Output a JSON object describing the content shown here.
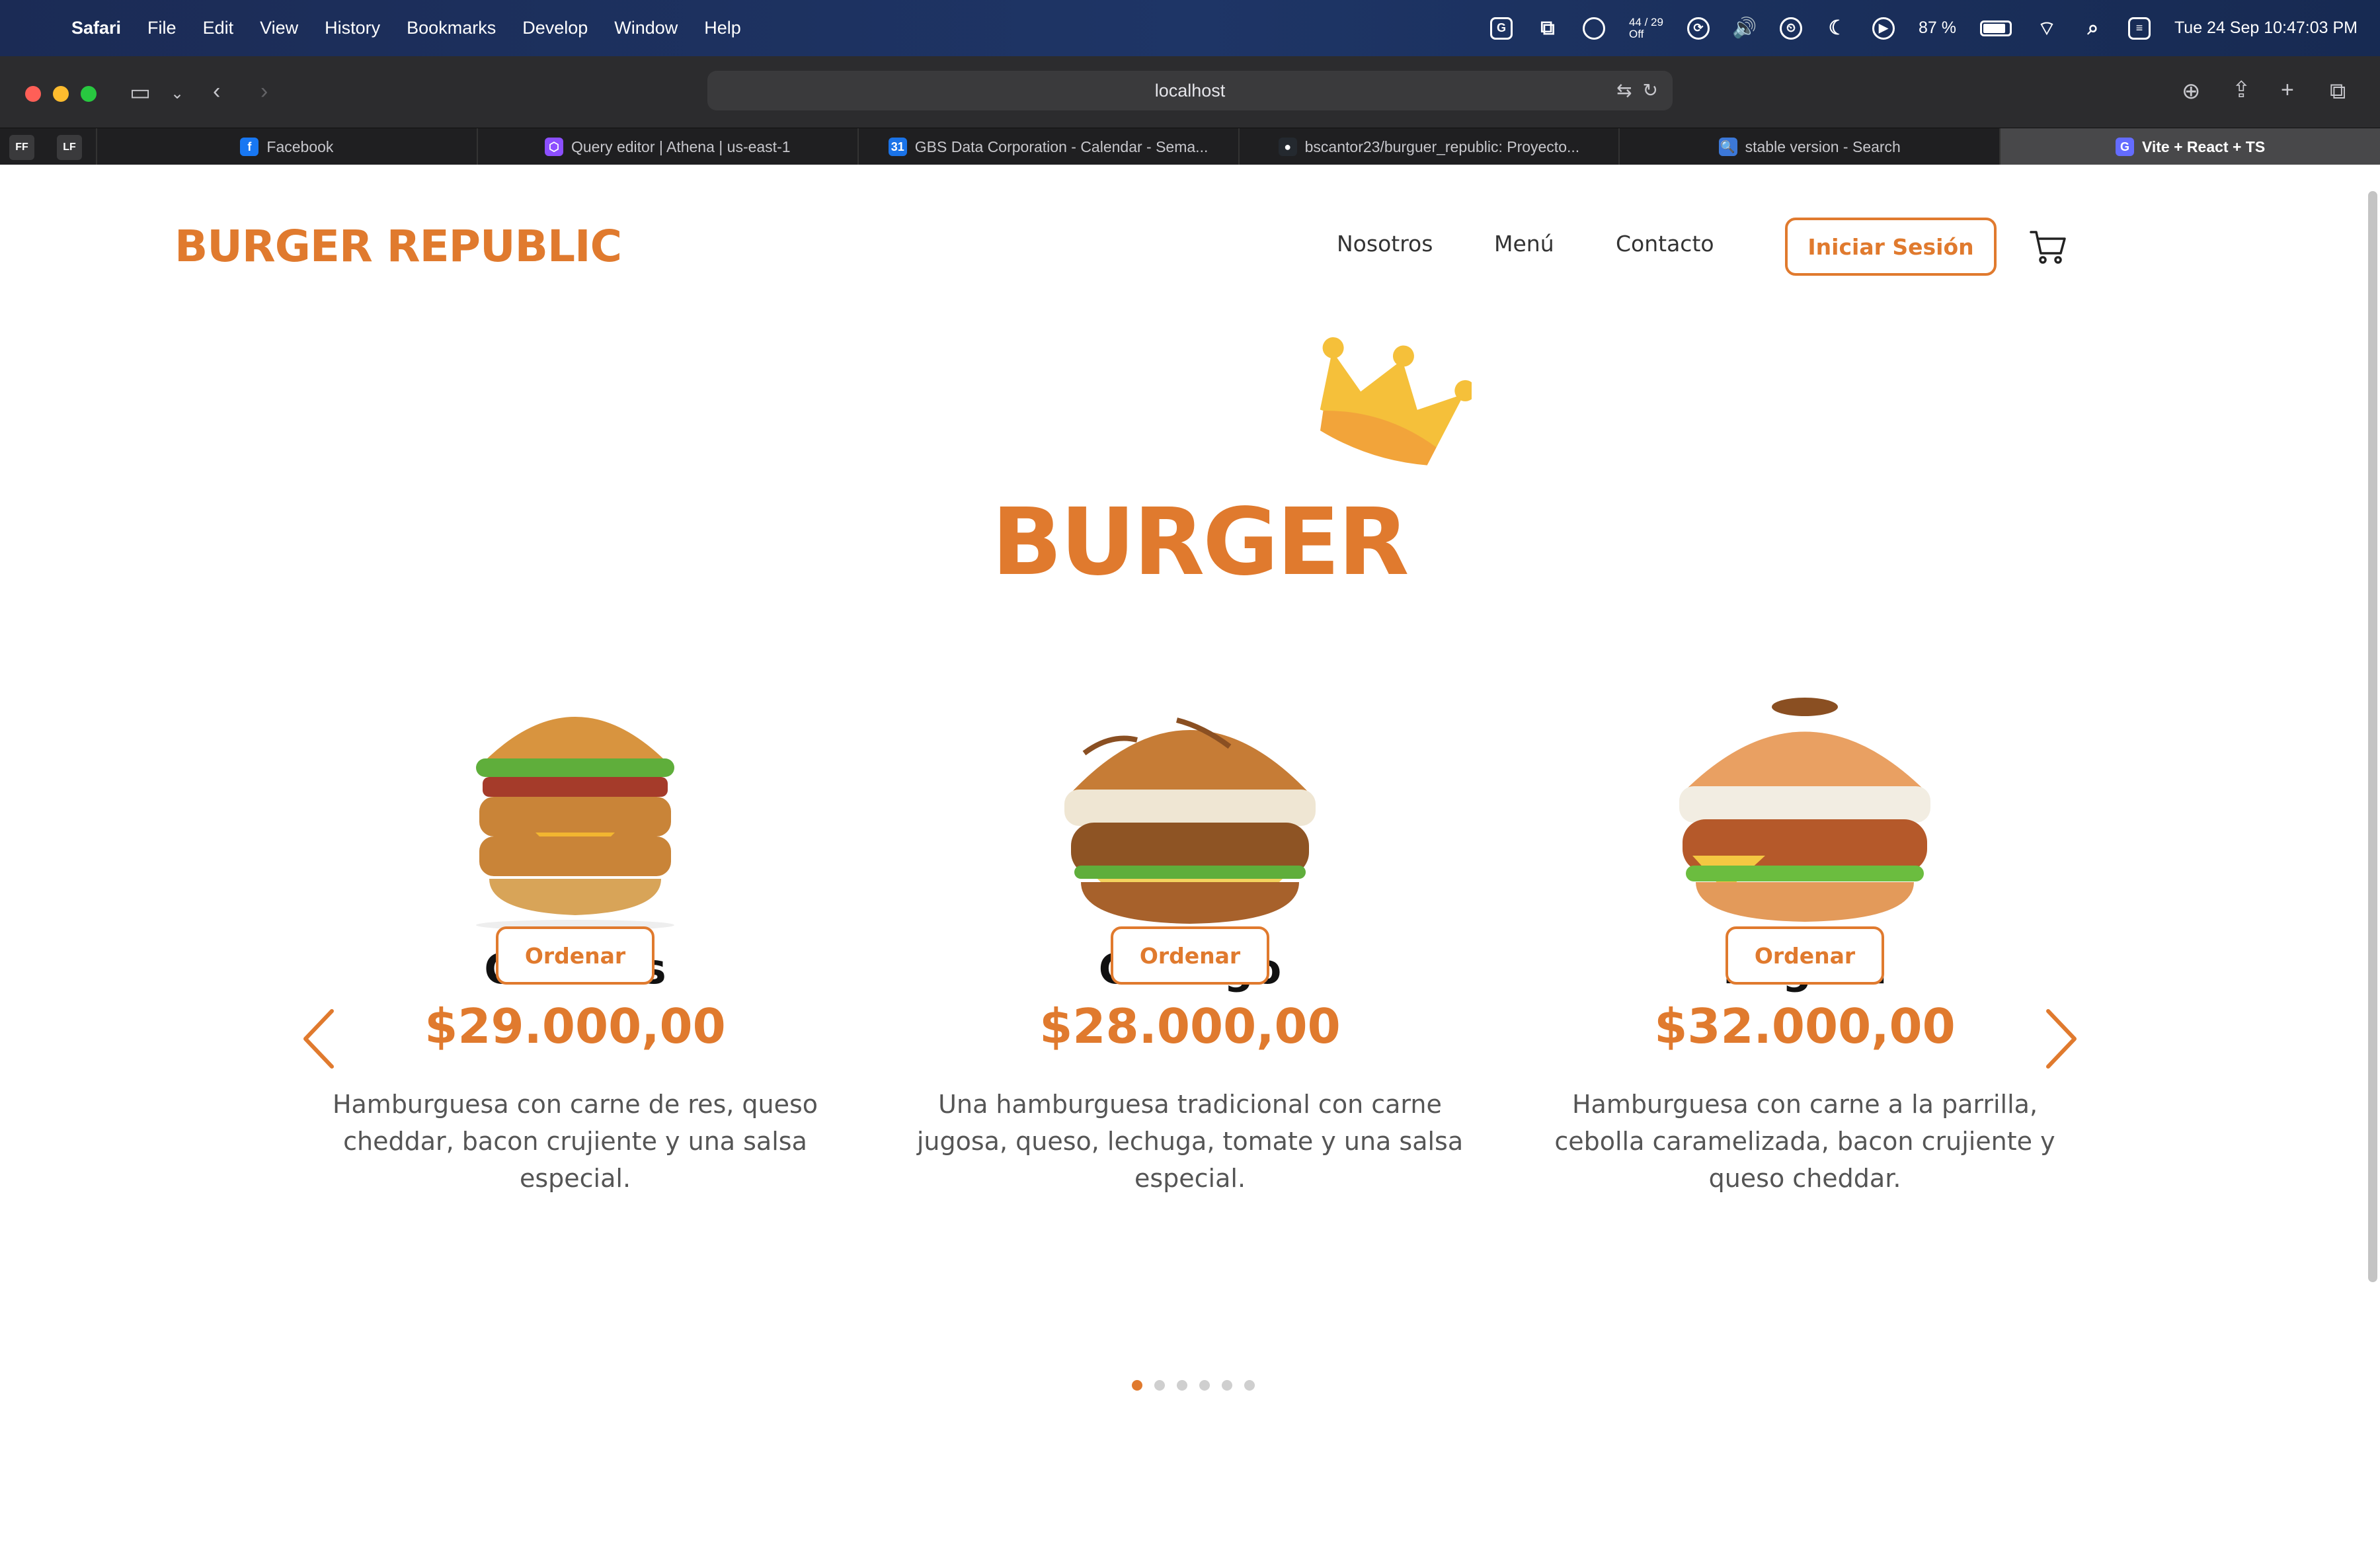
{
  "menubar": {
    "app": "Safari",
    "menus": [
      "File",
      "Edit",
      "View",
      "History",
      "Bookmarks",
      "Develop",
      "Window",
      "Help"
    ],
    "temp_top": "44 / 29",
    "temp_bottom": "Off",
    "battery": "87 %",
    "battery_level": 0.87,
    "datetime": "Tue 24 Sep  10:47:03 PM"
  },
  "browser": {
    "url": "localhost",
    "pinned": [
      "FF",
      "LF"
    ],
    "tabs": [
      {
        "title": "Facebook",
        "icon": "facebook-icon",
        "color": "#1877f2",
        "glyph": "f"
      },
      {
        "title": "Query editor | Athena | us-east-1",
        "icon": "aws-athena-icon",
        "color": "#8c4fff",
        "glyph": "⬡"
      },
      {
        "title": "GBS Data Corporation - Calendar - Sema...",
        "icon": "google-calendar-icon",
        "color": "#1a73e8",
        "glyph": "31"
      },
      {
        "title": "bscantor23/burguer_republic: Proyecto...",
        "icon": "github-icon",
        "color": "#24292f",
        "glyph": "●"
      },
      {
        "title": "stable version - Search",
        "icon": "bing-search-icon",
        "color": "#3c78d8",
        "glyph": "🔍"
      },
      {
        "title": "Vite + React + TS",
        "icon": "vite-icon",
        "color": "#646cff",
        "glyph": "G",
        "active": true
      }
    ]
  },
  "site": {
    "brand": "BURGER REPUBLIC",
    "nav": [
      "Nosotros",
      "Menú",
      "Contacto"
    ],
    "login": "Iniciar Sesión",
    "hero": "BURGER",
    "accent": "#e07a2e",
    "products": [
      {
        "name": "Caracas",
        "price": "$29.000,00",
        "desc": "Hamburguesa con carne de res, queso cheddar, bacon crujiente y una salsa especial.",
        "cta": "Ordenar"
      },
      {
        "name": "Chicago",
        "price": "$28.000,00",
        "desc": "Una hamburguesa tradicional con carne jugosa, queso, lechuga, tomate y una salsa especial.",
        "cta": "Ordenar"
      },
      {
        "name": "Bogotá",
        "price": "$32.000,00",
        "desc": "Hamburguesa con carne a la parrilla, cebolla caramelizada, bacon crujiente y queso cheddar.",
        "cta": "Ordenar"
      }
    ],
    "carousel": {
      "page_count": 6,
      "active": 0
    }
  }
}
